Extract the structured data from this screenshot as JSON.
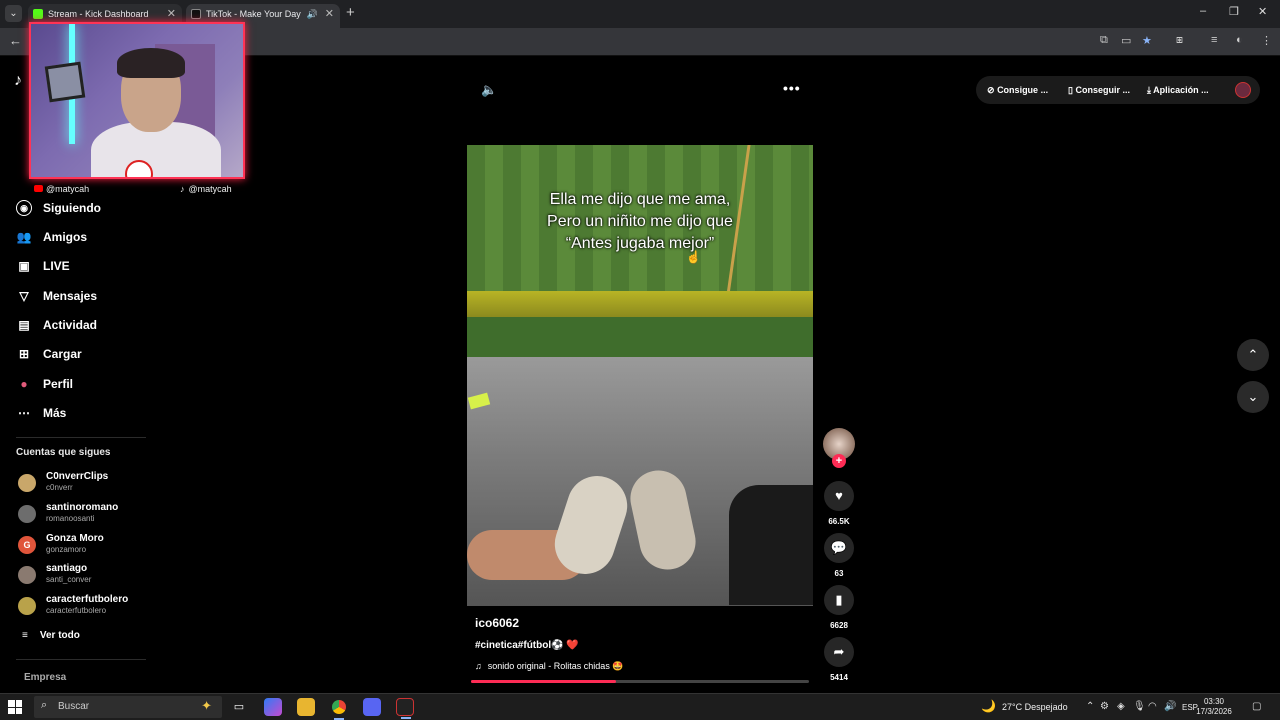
{
  "browser": {
    "tabs": [
      {
        "label": "Stream - Kick Dashboard",
        "color": "#53fc18"
      },
      {
        "label": "TikTok - Make Your Day",
        "color": "#ffffff"
      }
    ],
    "new_tab": "+",
    "window_controls": [
      "–",
      "❐",
      "✕"
    ]
  },
  "stream_overlay": {
    "socials": [
      {
        "handle": "@matycah",
        "icon": "youtube-icon"
      },
      {
        "handle": "@matycah",
        "icon": "tiktok-icon"
      }
    ]
  },
  "sidebar": {
    "nav": [
      {
        "label": "Siguiendo",
        "icon": "following-icon"
      },
      {
        "label": "Amigos",
        "icon": "friends-icon"
      },
      {
        "label": "LIVE",
        "icon": "live-icon"
      },
      {
        "label": "Mensajes",
        "icon": "messages-icon"
      },
      {
        "label": "Actividad",
        "icon": "activity-icon"
      },
      {
        "label": "Cargar",
        "icon": "upload-icon"
      },
      {
        "label": "Perfil",
        "icon": "profile-icon"
      },
      {
        "label": "Más",
        "icon": "more-icon"
      }
    ],
    "following_title": "Cuentas que sigues",
    "accounts": [
      {
        "name": "C0nverrClips",
        "handle": "c0nverr",
        "color": "#c9a76a"
      },
      {
        "name": "santinoromano",
        "handle": "romanoosanti",
        "color": "#6d6d6d"
      },
      {
        "name": "Gonza Moro",
        "handle": "gonzamoro",
        "color": "#e0553b",
        "initial": "G"
      },
      {
        "name": "santiago",
        "handle": "santi_conver",
        "color": "#8a7a70"
      },
      {
        "name": "caracterfutbolero",
        "handle": "caracterfutbolero",
        "color": "#b9a24a"
      }
    ],
    "see_all": "Ver todo",
    "company": "Empresa"
  },
  "topbar": {
    "actions": [
      {
        "label": "Consigue ...",
        "icon": "coin-icon"
      },
      {
        "label": "Conseguir ...",
        "icon": "phone-icon"
      },
      {
        "label": "Aplicación ...",
        "icon": "download-icon"
      }
    ]
  },
  "video": {
    "caption_lines": [
      "Ella me dijo que me ama,",
      "Pero un niñito me dijo que",
      "“Antes jugaba mejor”"
    ],
    "author": "ico6062",
    "tags": "#cinetica#fútbol⚽ ❤️",
    "sound": "sonido original - Rolitas chidas 🤩",
    "progress": 0.43
  },
  "actions": {
    "likes": "66.5K",
    "comments": "63",
    "saves": "6628",
    "shares": "5414"
  },
  "taskbar": {
    "search_placeholder": "Buscar",
    "weather": "27°C  Despejado",
    "language": "ESP",
    "time": "03:30",
    "date": "17/3/2026"
  }
}
